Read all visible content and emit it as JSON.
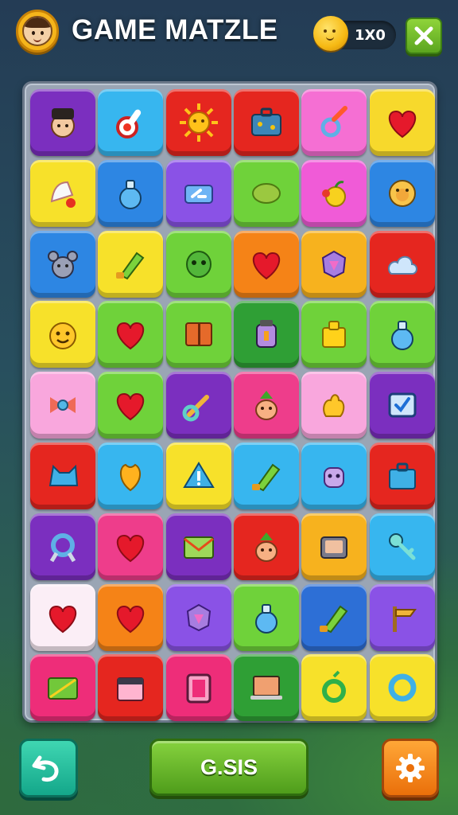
{
  "header": {
    "title": "GAME MATZLE",
    "coins": "1X0",
    "avatar_icon": "boy-avatar-icon",
    "coin_icon": "smiley-coin-icon",
    "close_icon": "close-x-icon"
  },
  "board": {
    "columns": 6,
    "rows": 9,
    "tiles": [
      {
        "color": "#7b2fbf",
        "icon": "person"
      },
      {
        "color": "#37b6ef",
        "icon": "thermometer"
      },
      {
        "color": "#e5261f",
        "icon": "sun"
      },
      {
        "color": "#e5261f",
        "icon": "suitcase"
      },
      {
        "color": "#f56fd3",
        "icon": "pin"
      },
      {
        "color": "#f7d92c",
        "icon": "heart"
      },
      {
        "color": "#f7e12a",
        "icon": "bell"
      },
      {
        "color": "#2d86e3",
        "icon": "potion"
      },
      {
        "color": "#8a52e6",
        "icon": "cassette"
      },
      {
        "color": "#6fd23a",
        "icon": "lemon"
      },
      {
        "color": "#f05bd7",
        "icon": "fruit"
      },
      {
        "color": "#2d86e3",
        "icon": "face"
      },
      {
        "color": "#2d86e3",
        "icon": "mouse"
      },
      {
        "color": "#f7e12a",
        "icon": "brush"
      },
      {
        "color": "#6fd23a",
        "icon": "alien"
      },
      {
        "color": "#f58317",
        "icon": "heart"
      },
      {
        "color": "#f7b21e",
        "icon": "gem"
      },
      {
        "color": "#e5261f",
        "icon": "cloud"
      },
      {
        "color": "#f7e12a",
        "icon": "smile"
      },
      {
        "color": "#6fd23a",
        "icon": "heart"
      },
      {
        "color": "#6fd23a",
        "icon": "book"
      },
      {
        "color": "#2f9f35",
        "icon": "jar"
      },
      {
        "color": "#6fd23a",
        "icon": "box"
      },
      {
        "color": "#6fd23a",
        "icon": "potion"
      },
      {
        "color": "#f9a7dd",
        "icon": "bow"
      },
      {
        "color": "#6fd23a",
        "icon": "heart"
      },
      {
        "color": "#7b2fbf",
        "icon": "wrench"
      },
      {
        "color": "#ee3d8b",
        "icon": "pineapple"
      },
      {
        "color": "#f9a7dd",
        "icon": "hand"
      },
      {
        "color": "#7b2fbf",
        "icon": "check"
      },
      {
        "color": "#e5261f",
        "icon": "cat"
      },
      {
        "color": "#37b6ef",
        "icon": "leaf"
      },
      {
        "color": "#f7e12a",
        "icon": "warning"
      },
      {
        "color": "#37b6ef",
        "icon": "brush"
      },
      {
        "color": "#37b6ef",
        "icon": "robot"
      },
      {
        "color": "#e5261f",
        "icon": "bag"
      },
      {
        "color": "#7b2fbf",
        "icon": "medal"
      },
      {
        "color": "#ee3d8b",
        "icon": "heart"
      },
      {
        "color": "#7b2fbf",
        "icon": "mail"
      },
      {
        "color": "#e5261f",
        "icon": "pineapple"
      },
      {
        "color": "#f7b21e",
        "icon": "tv"
      },
      {
        "color": "#37b6ef",
        "icon": "key"
      },
      {
        "color": "#fbeef6",
        "icon": "heart"
      },
      {
        "color": "#f58317",
        "icon": "heart"
      },
      {
        "color": "#8a52e6",
        "icon": "gem"
      },
      {
        "color": "#6fd23a",
        "icon": "potion"
      },
      {
        "color": "#2d6fd6",
        "icon": "brush"
      },
      {
        "color": "#8a52e6",
        "icon": "sign"
      },
      {
        "color": "#ee2d79",
        "icon": "note"
      },
      {
        "color": "#e5261f",
        "icon": "calendar"
      },
      {
        "color": "#ee2d79",
        "icon": "frame"
      },
      {
        "color": "#2f9f35",
        "icon": "laptop"
      },
      {
        "color": "#f7e12a",
        "icon": "ring"
      },
      {
        "color": "#f7e12a",
        "icon": "donut"
      }
    ]
  },
  "footer": {
    "undo_icon": "undo-arrow-icon",
    "main_label": "G.SIS",
    "settings_icon": "gear-icon"
  }
}
